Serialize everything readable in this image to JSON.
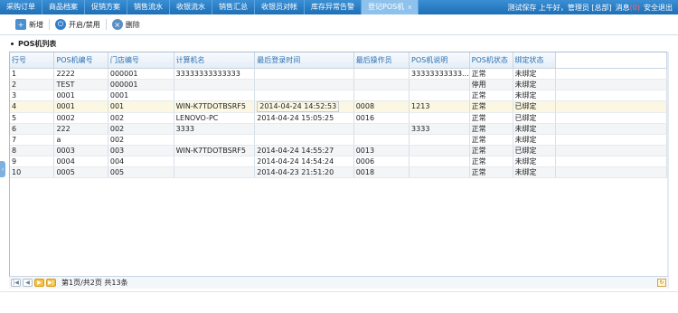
{
  "nav": {
    "tabs": [
      "采购订单",
      "商品档案",
      "促销方案",
      "销售流水",
      "收银流水",
      "销售汇总",
      "收银员对帐",
      "库存异常告警",
      "登记POS机"
    ],
    "active_tab_index": 8,
    "close_glyph": "x",
    "user_info": "测试保存 上午好，管理员 [总部]",
    "message_label": "消息",
    "message_count": "(0)",
    "logout": "安全退出"
  },
  "toolbar": {
    "add_label": "新增",
    "toggle_label": "开启/禁用",
    "delete_label": "删除"
  },
  "panel": {
    "title": "POS机列表"
  },
  "table": {
    "columns": [
      "行号",
      "POS机编号",
      "门店编号",
      "计算机名",
      "最后登录时间",
      "最后操作员",
      "POS机说明",
      "POS机状态",
      "绑定状态"
    ],
    "rows": [
      [
        "1",
        "2222",
        "000001",
        "33333333333333",
        "",
        "",
        "33333333333...",
        "正常",
        "未绑定"
      ],
      [
        "2",
        "TEST",
        "000001",
        "",
        "",
        "",
        "",
        "停用",
        "未绑定"
      ],
      [
        "3",
        "0001",
        "0001",
        "",
        "",
        "",
        "",
        "正常",
        "未绑定"
      ],
      [
        "4",
        "0001",
        "001",
        "WIN-K7TDOTBSRF5",
        "2014-04-24 14:52:53",
        "0008",
        "1213",
        "正常",
        "已绑定"
      ],
      [
        "5",
        "0002",
        "002",
        "LENOVO-PC",
        "2014-04-24 15:05:25",
        "0016",
        "",
        "正常",
        "已绑定"
      ],
      [
        "6",
        "222",
        "002",
        "3333",
        "",
        "",
        "3333",
        "正常",
        "未绑定"
      ],
      [
        "7",
        "a",
        "002",
        "",
        "",
        "",
        "",
        "正常",
        "未绑定"
      ],
      [
        "8",
        "0003",
        "003",
        "WIN-K7TDOTBSRF5",
        "2014-04-24 14:55:27",
        "0013",
        "",
        "正常",
        "已绑定"
      ],
      [
        "9",
        "0004",
        "004",
        "",
        "2014-04-24 14:54:24",
        "0006",
        "",
        "正常",
        "未绑定"
      ],
      [
        "10",
        "0005",
        "005",
        "",
        "2014-04-23 21:51:20",
        "0018",
        "",
        "正常",
        "未绑定"
      ]
    ],
    "highlight_row_index": 3
  },
  "pager": {
    "info": "第1页/共2页 共13条"
  },
  "colors": {
    "nav_bg": "#1f6fb6",
    "header_text": "#2a6fb3",
    "highlight_row": "#fbf7e2"
  }
}
